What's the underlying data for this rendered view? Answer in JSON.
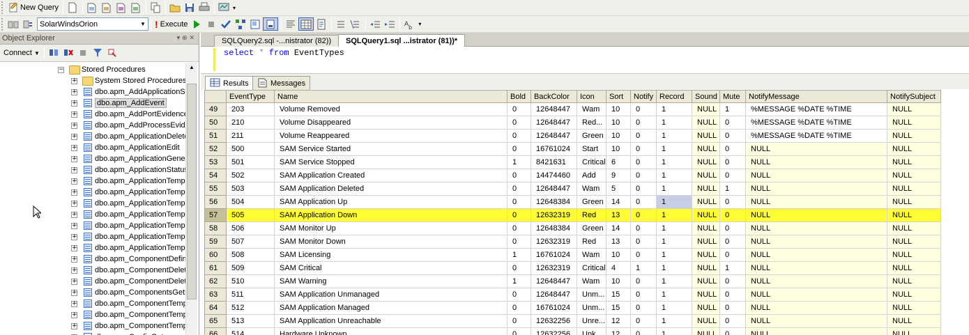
{
  "toolbar1": {
    "new_query_label": "New Query"
  },
  "toolbar2": {
    "database": "SolarWindsOrion",
    "execute_label": "Execute"
  },
  "object_explorer": {
    "title": "Object Explorer",
    "title_controls": "▾ ⊕ ✕",
    "connect_label": "Connect",
    "tree": [
      {
        "label": "Stored Procedures",
        "type": "folder",
        "expander": "−",
        "indent": 0
      },
      {
        "label": "System Stored Procedures",
        "type": "folder",
        "expander": "+",
        "indent": 1
      },
      {
        "label": "dbo.apm_AddApplicationSt",
        "type": "proc",
        "expander": "+",
        "indent": 1
      },
      {
        "label": "dbo.apm_AddEvent",
        "type": "proc",
        "expander": "+",
        "indent": 1,
        "selected": true
      },
      {
        "label": "dbo.apm_AddPortEvidence",
        "type": "proc",
        "expander": "+",
        "indent": 1
      },
      {
        "label": "dbo.apm_AddProcessEvide",
        "type": "proc",
        "expander": "+",
        "indent": 1
      },
      {
        "label": "dbo.apm_ApplicationDelete",
        "type": "proc",
        "expander": "+",
        "indent": 1
      },
      {
        "label": "dbo.apm_ApplicationEdit",
        "type": "proc",
        "expander": "+",
        "indent": 1
      },
      {
        "label": "dbo.apm_ApplicationGener",
        "type": "proc",
        "expander": "+",
        "indent": 1
      },
      {
        "label": "dbo.apm_ApplicationStatus",
        "type": "proc",
        "expander": "+",
        "indent": 1
      },
      {
        "label": "dbo.apm_ApplicationTempl",
        "type": "proc",
        "expander": "+",
        "indent": 1
      },
      {
        "label": "dbo.apm_ApplicationTempl",
        "type": "proc",
        "expander": "+",
        "indent": 1
      },
      {
        "label": "dbo.apm_ApplicationTempl",
        "type": "proc",
        "expander": "+",
        "indent": 1
      },
      {
        "label": "dbo.apm_ApplicationTempl",
        "type": "proc",
        "expander": "+",
        "indent": 1
      },
      {
        "label": "dbo.apm_ApplicationTempl",
        "type": "proc",
        "expander": "+",
        "indent": 1
      },
      {
        "label": "dbo.apm_ApplicationTempl",
        "type": "proc",
        "expander": "+",
        "indent": 1
      },
      {
        "label": "dbo.apm_ApplicationTempl",
        "type": "proc",
        "expander": "+",
        "indent": 1
      },
      {
        "label": "dbo.apm_ComponentDefin",
        "type": "proc",
        "expander": "+",
        "indent": 1
      },
      {
        "label": "dbo.apm_ComponentDelet",
        "type": "proc",
        "expander": "+",
        "indent": 1
      },
      {
        "label": "dbo.apm_ComponentDelet",
        "type": "proc",
        "expander": "+",
        "indent": 1
      },
      {
        "label": "dbo.apm_ComponentsGetB",
        "type": "proc",
        "expander": "+",
        "indent": 1
      },
      {
        "label": "dbo.apm_ComponentTemp",
        "type": "proc",
        "expander": "+",
        "indent": 1
      },
      {
        "label": "dbo.apm_ComponentTemp",
        "type": "proc",
        "expander": "+",
        "indent": 1
      },
      {
        "label": "dbo.apm_ComponentTemp",
        "type": "proc",
        "expander": "+",
        "indent": 1
      },
      {
        "label": "dbo.apm_ConfigGet",
        "type": "proc",
        "expander": "+",
        "indent": 1
      }
    ]
  },
  "doc_tabs": [
    {
      "label": "SQLQuery2.sql -...nistrator (82))",
      "active": false
    },
    {
      "label": "SQLQuery1.sql ...istrator (81))*",
      "active": true
    }
  ],
  "editor": {
    "kw1": "select",
    "star": "*",
    "kw2": "from",
    "table": "EventTypes"
  },
  "result_tabs": {
    "results_label": "Results",
    "messages_label": "Messages"
  },
  "grid": {
    "columns": [
      "",
      "EventType",
      "Name",
      "Bold",
      "BackColor",
      "Icon",
      "Sort",
      "Notify",
      "Record",
      "Sound",
      "Mute",
      "NotifyMessage",
      "NotifySubject"
    ],
    "highlighted_row": "57",
    "selected_cell": {
      "row": "56",
      "column": "Record"
    },
    "rows": [
      [
        "49",
        "203",
        "Volume Removed",
        "0",
        "12648447",
        "Wam",
        "10",
        "0",
        "1",
        "NULL",
        "1",
        "%MESSAGE %DATE %TIME",
        "NULL"
      ],
      [
        "50",
        "210",
        "Volume Disappeared",
        "0",
        "12648447",
        "Red...",
        "10",
        "0",
        "1",
        "NULL",
        "0",
        "%MESSAGE %DATE %TIME",
        "NULL"
      ],
      [
        "51",
        "211",
        "Volume Reappeared",
        "0",
        "12648447",
        "Green",
        "10",
        "0",
        "1",
        "NULL",
        "0",
        "%MESSAGE %DATE %TIME",
        "NULL"
      ],
      [
        "52",
        "500",
        "SAM Service Started",
        "0",
        "16761024",
        "Start",
        "10",
        "0",
        "1",
        "NULL",
        "0",
        "NULL",
        "NULL"
      ],
      [
        "53",
        "501",
        "SAM Service Stopped",
        "1",
        "8421631",
        "Critical",
        "6",
        "0",
        "1",
        "NULL",
        "0",
        "NULL",
        "NULL"
      ],
      [
        "54",
        "502",
        "SAM Application Created",
        "0",
        "14474460",
        "Add",
        "9",
        "0",
        "1",
        "NULL",
        "0",
        "NULL",
        "NULL"
      ],
      [
        "55",
        "503",
        "SAM Application Deleted",
        "0",
        "12648447",
        "Wam",
        "5",
        "0",
        "1",
        "NULL",
        "1",
        "NULL",
        "NULL"
      ],
      [
        "56",
        "504",
        "SAM Application Up",
        "0",
        "12648384",
        "Green",
        "14",
        "0",
        "1",
        "NULL",
        "0",
        "NULL",
        "NULL"
      ],
      [
        "57",
        "505",
        "SAM Application Down",
        "0",
        "12632319",
        "Red",
        "13",
        "0",
        "1",
        "NULL",
        "0",
        "NULL",
        "NULL"
      ],
      [
        "58",
        "506",
        "SAM Monitor Up",
        "0",
        "12648384",
        "Green",
        "14",
        "0",
        "1",
        "NULL",
        "0",
        "NULL",
        "NULL"
      ],
      [
        "59",
        "507",
        "SAM Monitor Down",
        "0",
        "12632319",
        "Red",
        "13",
        "0",
        "1",
        "NULL",
        "0",
        "NULL",
        "NULL"
      ],
      [
        "60",
        "508",
        "SAM Licensing",
        "1",
        "16761024",
        "Wam",
        "10",
        "0",
        "1",
        "NULL",
        "0",
        "NULL",
        "NULL"
      ],
      [
        "61",
        "509",
        "SAM Critical",
        "0",
        "12632319",
        "Critical",
        "4",
        "1",
        "1",
        "NULL",
        "1",
        "NULL",
        "NULL"
      ],
      [
        "62",
        "510",
        "SAM Warning",
        "1",
        "12648447",
        "Wam",
        "10",
        "0",
        "1",
        "NULL",
        "0",
        "NULL",
        "NULL"
      ],
      [
        "63",
        "511",
        "SAM Application Unmanaged",
        "0",
        "12648447",
        "Unm...",
        "15",
        "0",
        "1",
        "NULL",
        "0",
        "NULL",
        "NULL"
      ],
      [
        "64",
        "512",
        "SAM Application Managed",
        "0",
        "16761024",
        "Unm...",
        "15",
        "0",
        "1",
        "NULL",
        "0",
        "NULL",
        "NULL"
      ],
      [
        "65",
        "513",
        "SAM Application Unreachable",
        "0",
        "12632256",
        "Unre...",
        "12",
        "0",
        "1",
        "NULL",
        "0",
        "NULL",
        "NULL"
      ],
      [
        "66",
        "514",
        "Hardware Unknown",
        "0",
        "12632256",
        "Unk...",
        "12",
        "0",
        "1",
        "NULL",
        "0",
        "NULL",
        "NULL"
      ]
    ]
  },
  "colors": {
    "highlight_row": "#ffff33",
    "null_cell": "#ffffe1",
    "keyword": "#0000ff"
  }
}
